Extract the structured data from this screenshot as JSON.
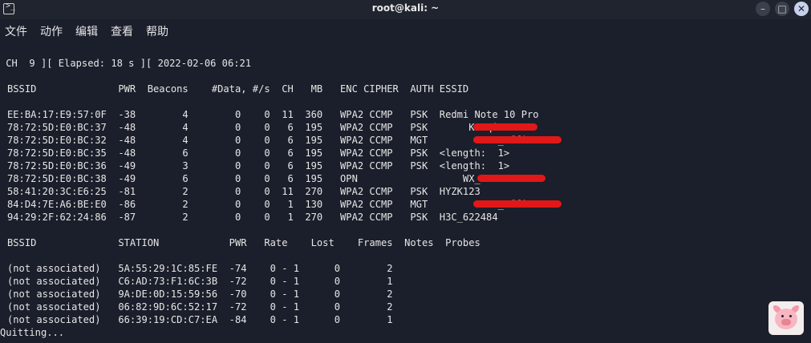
{
  "window": {
    "title": "root@kali: ~",
    "minimize_glyph": "–",
    "maximize_glyph": "□",
    "close_glyph": "✕",
    "icon": "terminal-icon"
  },
  "menu": [
    "文件",
    "动作",
    "编辑",
    "查看",
    "帮助"
  ],
  "terminal": {
    "status_line": " CH  9 ][ Elapsed: 18 s ][ 2022-02-06 06:21",
    "ap_header": "BSSID              PWR  Beacons    #Data, #/s  CH   MB   ENC CIPHER  AUTH ESSID",
    "ap_rows": [
      "EE:BA:17:E9:57:0F  -38        4        0    0  11  360   WPA2 CCMP   PSK  Redmi Note 10 Pro",
      "78:72:5D:E0:BC:37  -48        4        0    0   6  195   WPA2 CCMP   PSK       Kaoqin01",
      "78:72:5D:E0:BC:32  -48        4        0    0   6  195   WPA2 CCMP   MGT            _Office",
      "78:72:5D:E0:BC:35  -48        6        0    0   6  195   WPA2 CCMP   PSK  <length:  1>",
      "78:72:5D:E0:BC:36  -49        3        0    0   6  195   WPA2 CCMP   PSK  <length:  1>",
      "78:72:5D:E0:BC:38  -49        6        0    0   6  195   OPN                  WX_Guest",
      "58:41:20:3C:E6:25  -81        2        0    0  11  270   WPA2 CCMP   PSK  HYZK123",
      "84:D4:7E:A6:BE:E0  -86        2        0    0   1  130   WPA2 CCMP   MGT            _Office",
      "94:29:2F:62:24:86  -87        2        0    0   1  270   WPA2 CCMP   PSK  H3C_622484"
    ],
    "sta_header": "BSSID              STATION            PWR   Rate    Lost    Frames  Notes  Probes",
    "sta_rows": [
      "(not associated)   5A:55:29:1C:85:FE  -74    0 - 1      0        2",
      "(not associated)   C6:AD:73:F1:6C:3B  -72    0 - 1      0        1",
      "(not associated)   9A:DE:0D:15:59:56  -70    0 - 1      0        2",
      "(not associated)   06:82:9D:6C:52:17  -72    0 - 1      0        2",
      "(not associated)   66:39:19:CD:C7:EA  -84    0 - 1      0        1"
    ],
    "footer": "Quitting..."
  },
  "colors": {
    "background": "#1b1f2b",
    "text": "#e6e6e6",
    "redaction": "#e01818"
  }
}
